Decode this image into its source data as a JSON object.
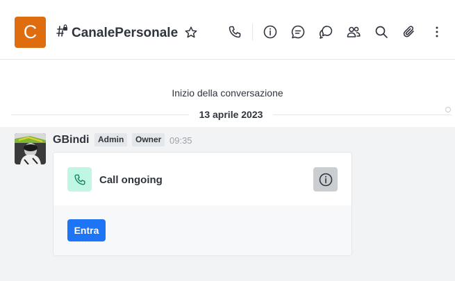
{
  "header": {
    "room_initial": "C",
    "room_name": "CanalePersonale",
    "avatar_color": "#e06c10",
    "icons": [
      "phone-icon",
      "info-icon",
      "discussion-icon",
      "threads-icon",
      "members-icon",
      "search-icon",
      "attachment-icon",
      "kebab-menu-icon"
    ]
  },
  "feed": {
    "conversation_start": "Inizio della conversazione",
    "date_divider": "13 aprile 2023"
  },
  "message": {
    "username": "GBindi",
    "roles": [
      "Admin",
      "Owner"
    ],
    "time": "09:35",
    "call": {
      "title": "Call ongoing",
      "join_label": "Entra",
      "accent": "#1d74f5",
      "icon_bg": "#c0f6e4"
    }
  }
}
